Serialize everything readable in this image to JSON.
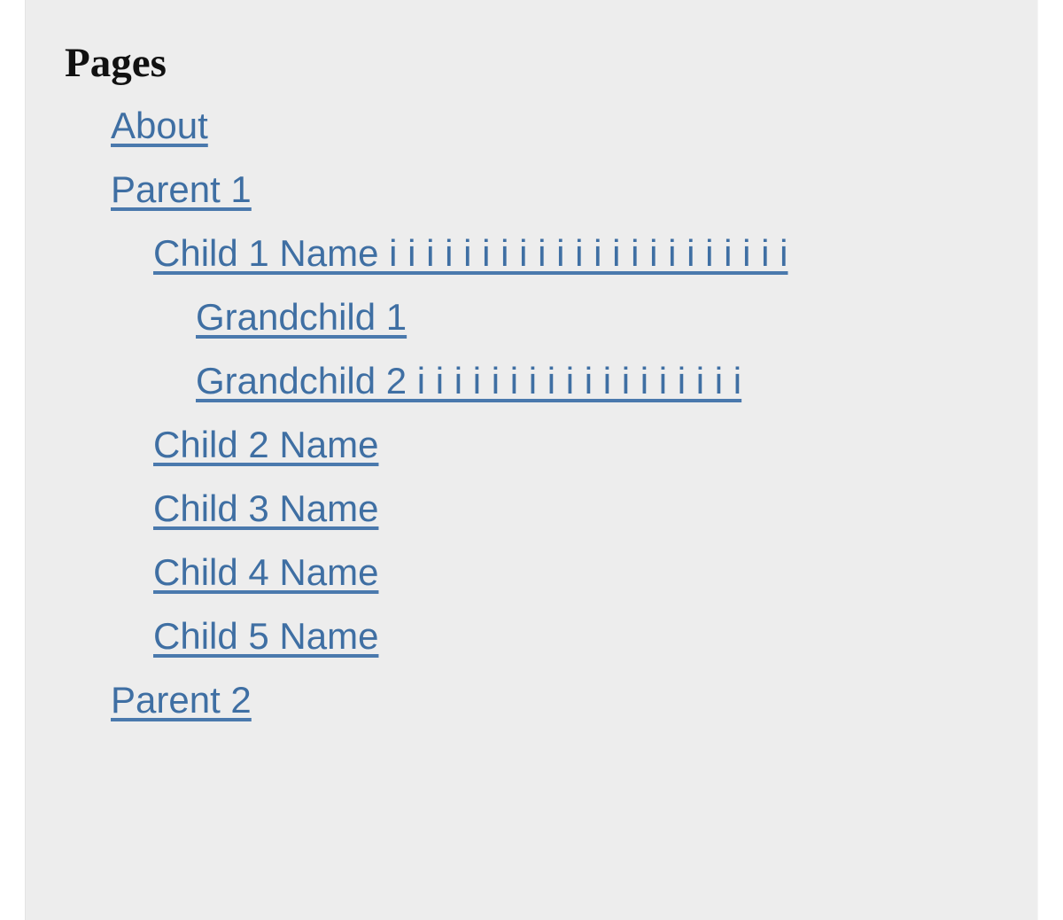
{
  "widget": {
    "title": "Pages",
    "items": [
      {
        "label": "About",
        "level": 1
      },
      {
        "label": "Parent 1",
        "level": 1,
        "children": [
          {
            "label": "Child 1 Name i i i i i i i i i i i i i i i i i i i i i i",
            "level": 2,
            "children": [
              {
                "label": "Grandchild 1",
                "level": 3
              },
              {
                "label": "Grandchild 2 i i i i i i i i i i i i i i i i i i",
                "level": 3
              }
            ]
          },
          {
            "label": "Child 2 Name",
            "level": 2
          },
          {
            "label": "Child 3 Name",
            "level": 2
          },
          {
            "label": "Child 4 Name",
            "level": 2
          },
          {
            "label": "Child 5 Name",
            "level": 2
          }
        ]
      },
      {
        "label": "Parent 2",
        "level": 1
      }
    ]
  },
  "colors": {
    "page_background": "#ffffff",
    "content_background": "#ededed",
    "link": "#3f6fa3",
    "link_underline": "#4a79ad",
    "heading": "#111111"
  }
}
